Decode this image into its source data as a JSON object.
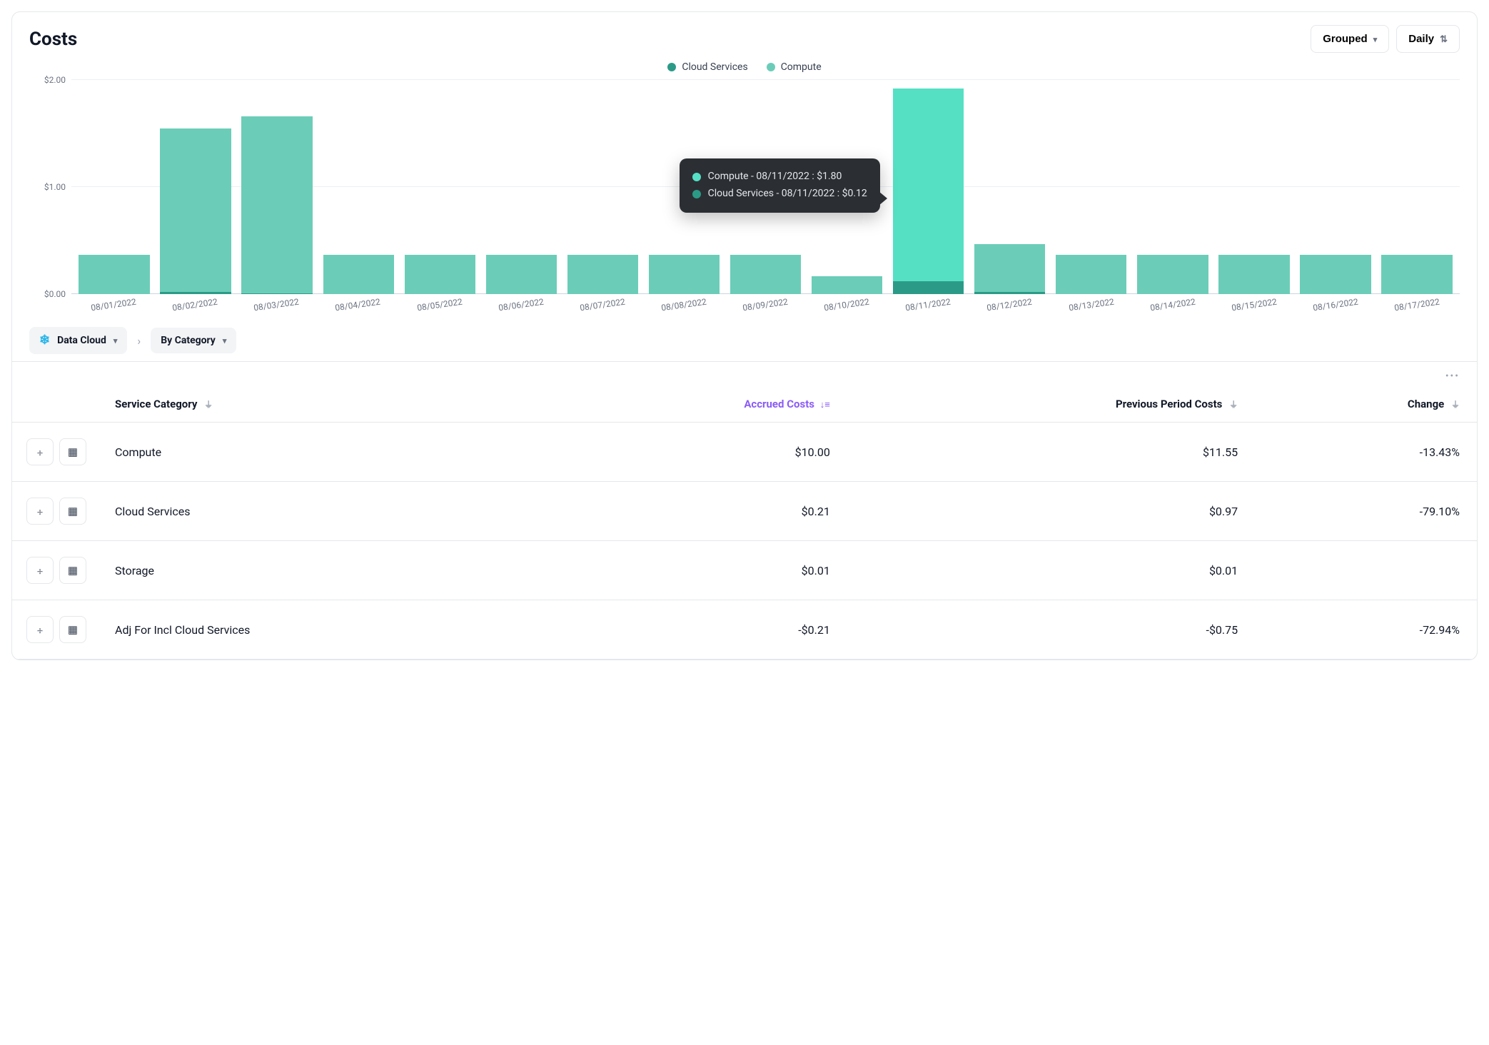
{
  "header": {
    "title": "Costs",
    "grouped_label": "Grouped",
    "interval_label": "Daily"
  },
  "legend": {
    "cloud_services": "Cloud Services",
    "compute": "Compute"
  },
  "tooltip": {
    "line1": "Compute - 08/11/2022 : $1.80",
    "line2": "Cloud Services - 08/11/2022 : $0.12"
  },
  "breadcrumb": {
    "root": "Data Cloud",
    "current": "By Category"
  },
  "table": {
    "headers": {
      "service_category": "Service Category",
      "accrued": "Accrued Costs",
      "previous": "Previous Period Costs",
      "change": "Change"
    },
    "rows": [
      {
        "category": "Compute",
        "accrued": "$10.00",
        "previous": "$11.55",
        "change": "-13.43%"
      },
      {
        "category": "Cloud Services",
        "accrued": "$0.21",
        "previous": "$0.97",
        "change": "-79.10%"
      },
      {
        "category": "Storage",
        "accrued": "$0.01",
        "previous": "$0.01",
        "change": ""
      },
      {
        "category": "Adj For Incl Cloud Services",
        "accrued": "-$0.21",
        "previous": "-$0.75",
        "change": "-72.94%"
      }
    ]
  },
  "chart_data": {
    "type": "bar",
    "stacked": true,
    "title": "Costs",
    "xlabel": "",
    "ylabel": "",
    "ylim": [
      0,
      2.0
    ],
    "yticks": [
      "$0.00",
      "$1.00",
      "$2.00"
    ],
    "categories": [
      "08/01/2022",
      "08/02/2022",
      "08/03/2022",
      "08/04/2022",
      "08/05/2022",
      "08/06/2022",
      "08/07/2022",
      "08/08/2022",
      "08/09/2022",
      "08/10/2022",
      "08/11/2022",
      "08/12/2022",
      "08/13/2022",
      "08/14/2022",
      "08/15/2022",
      "08/16/2022",
      "08/17/2022"
    ],
    "series": [
      {
        "name": "Compute",
        "values": [
          0.37,
          1.53,
          1.65,
          0.37,
          0.37,
          0.37,
          0.37,
          0.37,
          0.37,
          0.17,
          1.8,
          0.45,
          0.37,
          0.37,
          0.37,
          0.37,
          0.37
        ]
      },
      {
        "name": "Cloud Services",
        "values": [
          0.0,
          0.02,
          0.01,
          0.0,
          0.0,
          0.0,
          0.0,
          0.0,
          0.0,
          0.0,
          0.12,
          0.02,
          0.0,
          0.0,
          0.0,
          0.0,
          0.0
        ]
      }
    ],
    "highlight_index": 10,
    "legend_position": "top",
    "grid": true
  }
}
